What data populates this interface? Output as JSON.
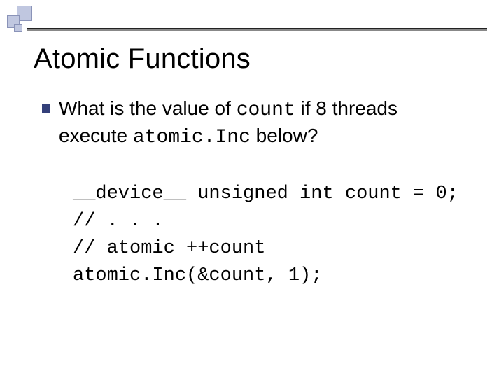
{
  "title": "Atomic Functions",
  "bullet": {
    "t1": "What is the value of ",
    "code1": "count",
    "t2": " if 8 threads execute ",
    "code2": "atomic.Inc",
    "t3": " below?"
  },
  "code": {
    "l1": "__device__ unsigned int count = 0;",
    "l2": "// . . .",
    "l3": "// atomic ++count",
    "l4": "atomic.Inc(&count, 1);"
  }
}
